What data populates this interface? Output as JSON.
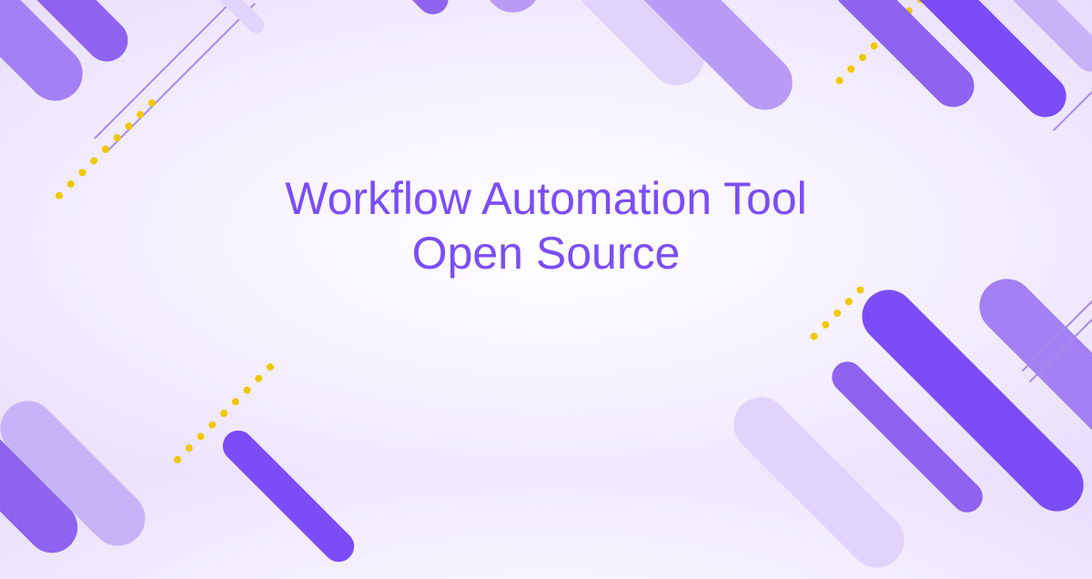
{
  "hero": {
    "line1": "Workflow Automation Tool",
    "line2": "Open Source"
  },
  "colors": {
    "primary": "#7b4df7",
    "accent_dots": "#f0c800"
  }
}
